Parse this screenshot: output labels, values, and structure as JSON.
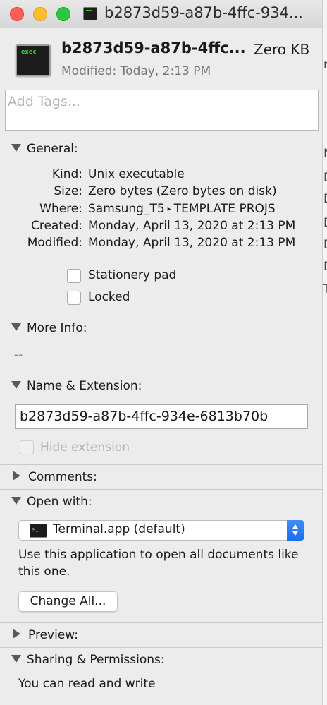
{
  "window": {
    "title": "b2873d59-a87b-4ffc-934..."
  },
  "header": {
    "icon_label": "exec",
    "file_name": "b2873d59-a87b-4ffc...",
    "file_size": "Zero KB",
    "modified": "Modified: Today, 2:13 PM"
  },
  "tags": {
    "placeholder": "Add Tags..."
  },
  "general": {
    "heading": "General:",
    "rows": [
      {
        "key": "Kind:",
        "value": "Unix executable"
      },
      {
        "key": "Size:",
        "value": "Zero bytes (Zero bytes on disk)"
      },
      {
        "key": "Where:",
        "value_a": "Samsung_T5",
        "separator": "▸",
        "value_b": "TEMPLATE PROJS"
      },
      {
        "key": "Created:",
        "value": "Monday, April 13, 2020 at 2:13 PM"
      },
      {
        "key": "Modified:",
        "value": "Monday, April 13, 2020 at 2:13 PM"
      }
    ],
    "stationery_label": "Stationery pad",
    "stationery_checked": false,
    "locked_label": "Locked",
    "locked_checked": false
  },
  "more_info": {
    "heading": "More Info:",
    "value": "--"
  },
  "name_extension": {
    "heading": "Name & Extension:",
    "value": "b2873d59-a87b-4ffc-934e-6813b70b",
    "hide_extension_label": "Hide extension",
    "hide_extension_checked": false
  },
  "comments": {
    "heading": "Comments:"
  },
  "open_with": {
    "heading": "Open with:",
    "app_icon_glyph": ">_",
    "selected_app": "Terminal.app (default)",
    "description": "Use this application to open all documents like this one.",
    "change_all_label": "Change All..."
  },
  "preview": {
    "heading": "Preview:"
  },
  "sharing": {
    "heading": "Sharing & Permissions:",
    "text": "You can read and write"
  },
  "colors": {
    "accent": "#1a6ff0",
    "close": "#fe5f57",
    "minimize": "#febc2e",
    "zoom": "#28c840"
  }
}
